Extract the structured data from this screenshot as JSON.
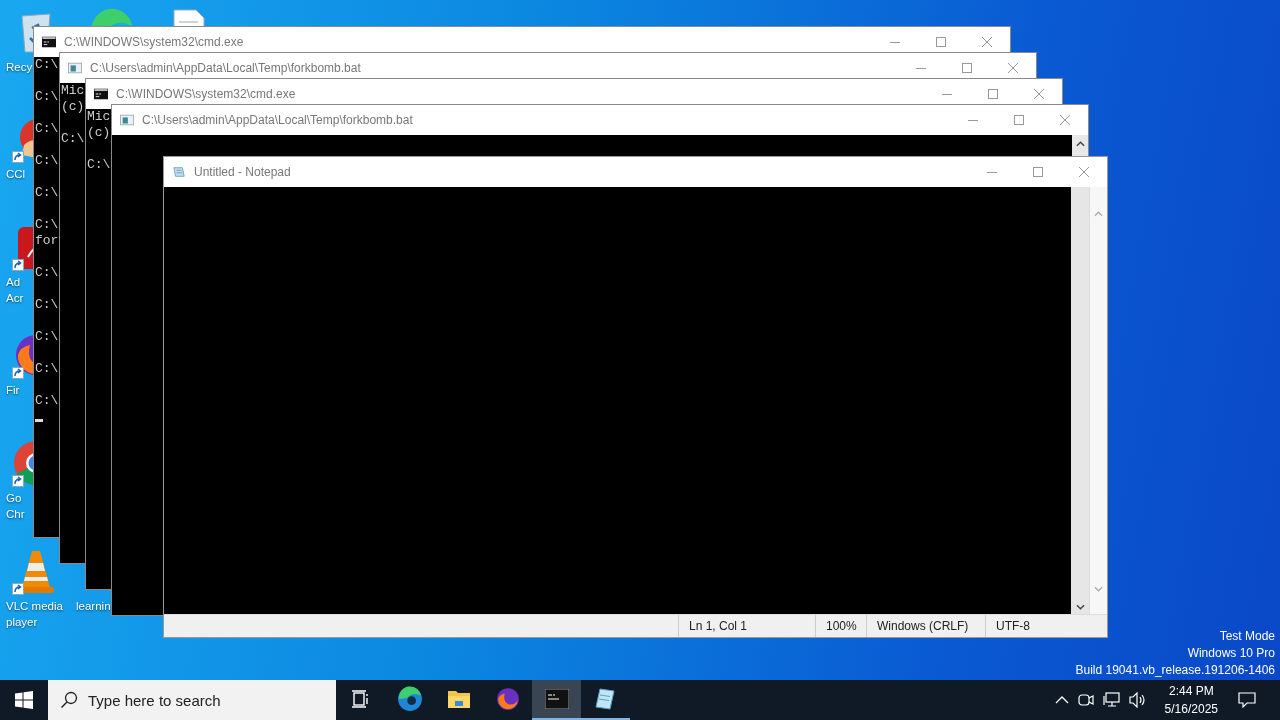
{
  "desktop_icons": [
    {
      "kind": "recycle-bin",
      "label": [
        "Recy"
      ],
      "shortcut": false
    },
    {
      "kind": "edge"
    },
    {
      "kind": "document"
    },
    {
      "kind": "ccleaner",
      "label": [
        "CCl"
      ],
      "shortcut": true
    },
    {
      "kind": "acrobat",
      "label": [
        "Ad",
        "Acr"
      ],
      "shortcut": true
    },
    {
      "kind": "firefox",
      "label": [
        "Fir"
      ],
      "shortcut": true
    },
    {
      "kind": "chrome",
      "label": [
        "Go",
        "Chr"
      ],
      "shortcut": true
    },
    {
      "kind": "vlc",
      "label": [
        "VLC media",
        "player"
      ],
      "shortcut": true
    },
    {
      "label": [
        "learnin"
      ]
    }
  ],
  "windows": [
    {
      "kind": "cmd",
      "title": "C:\\WINDOWS\\system32\\cmd.exe",
      "blocks": [
        [
          "C:\\"
        ],
        [
          "C:\\"
        ],
        [
          "C:\\"
        ],
        [
          "C:\\"
        ],
        [
          "C:\\"
        ],
        [
          "C:\\",
          "for"
        ],
        [
          "C:\\"
        ],
        [
          "C:\\"
        ],
        [
          "C:\\"
        ],
        [
          "C:\\"
        ],
        [
          "C:\\"
        ]
      ],
      "cursor": true
    },
    {
      "kind": "batch",
      "title": "C:\\Users\\admin\\AppData\\Local\\Temp\\forkbomb.bat",
      "blocks": [
        [
          "Mic",
          "(c)"
        ],
        [
          "C:\\"
        ]
      ]
    },
    {
      "kind": "cmd",
      "title": "C:\\WINDOWS\\system32\\cmd.exe",
      "blocks": [
        [
          "Mic",
          "(c)"
        ],
        [
          "C:\\"
        ]
      ]
    },
    {
      "kind": "batch",
      "title": "C:\\Users\\admin\\AppData\\Local\\Temp\\forkbomb.bat",
      "scrollbar": true
    }
  ],
  "notepad": {
    "title": "Untitled - Notepad",
    "status": [
      "Ln 1, Col 1",
      "100%",
      "Windows (CRLF)",
      "UTF-8"
    ]
  },
  "os_info": [
    "Test Mode",
    "Windows 10 Pro",
    "Build 19041.vb_release.191206-1406"
  ],
  "taskbar": {
    "search_placeholder": "Type here to search",
    "apps": [
      {
        "kind": "task-view",
        "open": false,
        "active": false
      },
      {
        "kind": "edge",
        "open": false,
        "active": false
      },
      {
        "kind": "explorer",
        "open": false,
        "active": false
      },
      {
        "kind": "firefox",
        "open": false,
        "active": false
      },
      {
        "kind": "cmd",
        "open": true,
        "active": true
      },
      {
        "kind": "notepad",
        "open": true,
        "active": false
      }
    ],
    "time": "2:44 PM",
    "date": "5/16/2025"
  }
}
